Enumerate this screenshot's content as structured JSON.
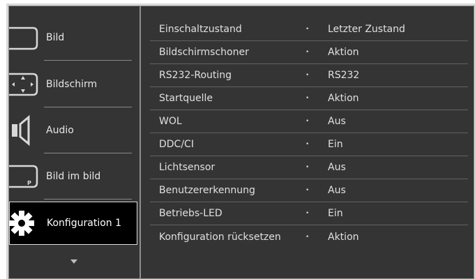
{
  "sidebar": {
    "items": [
      {
        "label": "Bild",
        "icon": "picture-icon"
      },
      {
        "label": "Bildschirm",
        "icon": "screen-icon"
      },
      {
        "label": "Audio",
        "icon": "speaker-icon"
      },
      {
        "label": "Bild im bild",
        "icon": "pip-icon"
      },
      {
        "label": "Konfiguration 1",
        "icon": "gear-icon",
        "selected": true
      }
    ],
    "scroll_icon": "triangle-down-icon"
  },
  "settings": {
    "rows": [
      {
        "name": "Einschaltzustand",
        "value": "Letzter Zustand"
      },
      {
        "name": "Bildschirmschoner",
        "value": "Aktion"
      },
      {
        "name": "RS232-Routing",
        "value": "RS232"
      },
      {
        "name": "Startquelle",
        "value": "Aktion"
      },
      {
        "name": "WOL",
        "value": "Aus"
      },
      {
        "name": "DDC/CI",
        "value": "Ein"
      },
      {
        "name": "Lichtsensor",
        "value": "Aus"
      },
      {
        "name": "Benutzererkennung",
        "value": "Aus"
      },
      {
        "name": "Betriebs-LED",
        "value": "Ein"
      },
      {
        "name": "Konfiguration rücksetzen",
        "value": "Aktion"
      }
    ],
    "bullet": "•"
  },
  "colors": {
    "panel_bg": "#343434",
    "selected_bg": "#000000",
    "text": "#e0e0e0"
  }
}
